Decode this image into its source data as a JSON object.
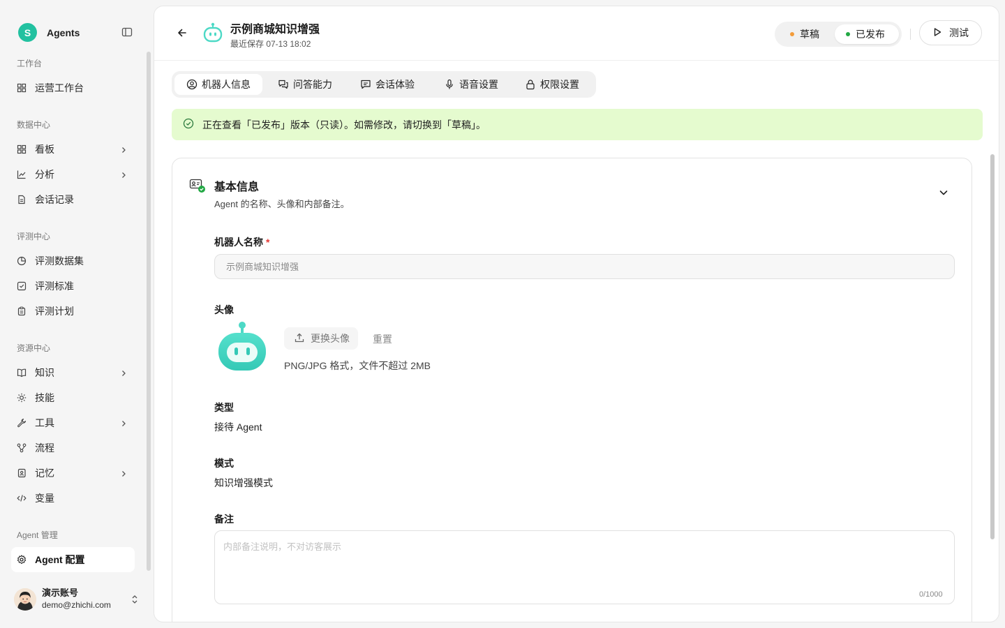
{
  "sidebar": {
    "brand": {
      "logo_letter": "S",
      "name": "Agents"
    },
    "sections": {
      "workbench": "工作台",
      "data_center": "数据中心",
      "eval_center": "评测中心",
      "resource_center": "资源中心",
      "agent_mgmt": "Agent 管理"
    },
    "items": {
      "ops_workbench": "运营工作台",
      "dashboard": "看板",
      "analysis": "分析",
      "conversations": "会话记录",
      "eval_datasets": "评测数据集",
      "eval_criteria": "评测标准",
      "eval_plans": "评测计划",
      "knowledge": "知识",
      "skills": "技能",
      "tools": "工具",
      "flows": "流程",
      "memory": "记忆",
      "variables": "变量",
      "agent_config": "Agent 配置"
    },
    "user": {
      "name": "演示账号",
      "email": "demo@zhichi.com"
    }
  },
  "header": {
    "title": "示例商城知识增强",
    "subtitle": "最近保存 07-13 18:02",
    "version_toggle": {
      "draft": "草稿",
      "published": "已发布",
      "selected": "published"
    },
    "test_button": "测试"
  },
  "tabs": [
    {
      "label": "机器人信息",
      "icon": "user-circle-icon",
      "active": true
    },
    {
      "label": "问答能力",
      "icon": "chat-bubbles-icon",
      "active": false
    },
    {
      "label": "会话体验",
      "icon": "message-square-icon",
      "active": false
    },
    {
      "label": "语音设置",
      "icon": "microphone-icon",
      "active": false
    },
    {
      "label": "权限设置",
      "icon": "lock-icon",
      "active": false
    }
  ],
  "notice": "正在查看「已发布」版本（只读）。如需修改，请切换到「草稿」。",
  "card": {
    "title": "基本信息",
    "description": "Agent 的名称、头像和内部备注。",
    "fields": {
      "name_label": "机器人名称",
      "name_required": "*",
      "name_placeholder": "示例商城知识增强",
      "avatar_label": "头像",
      "upload_button": "更换头像",
      "reset_button": "重置",
      "avatar_hint": "PNG/JPG 格式，文件不超过 2MB",
      "type_label": "类型",
      "type_value": "接待 Agent",
      "mode_label": "模式",
      "mode_value": "知识增强模式",
      "notes_label": "备注",
      "notes_placeholder": "内部备注说明，不对访客展示",
      "notes_counter": "0/1000"
    }
  },
  "colors": {
    "brand": "#22c1a0",
    "bot_teal": "#4dd9c6",
    "draft_dot": "#f39c3a",
    "published_dot": "#22a844",
    "notice_bg": "#e5fbcf",
    "required": "#e53935"
  }
}
